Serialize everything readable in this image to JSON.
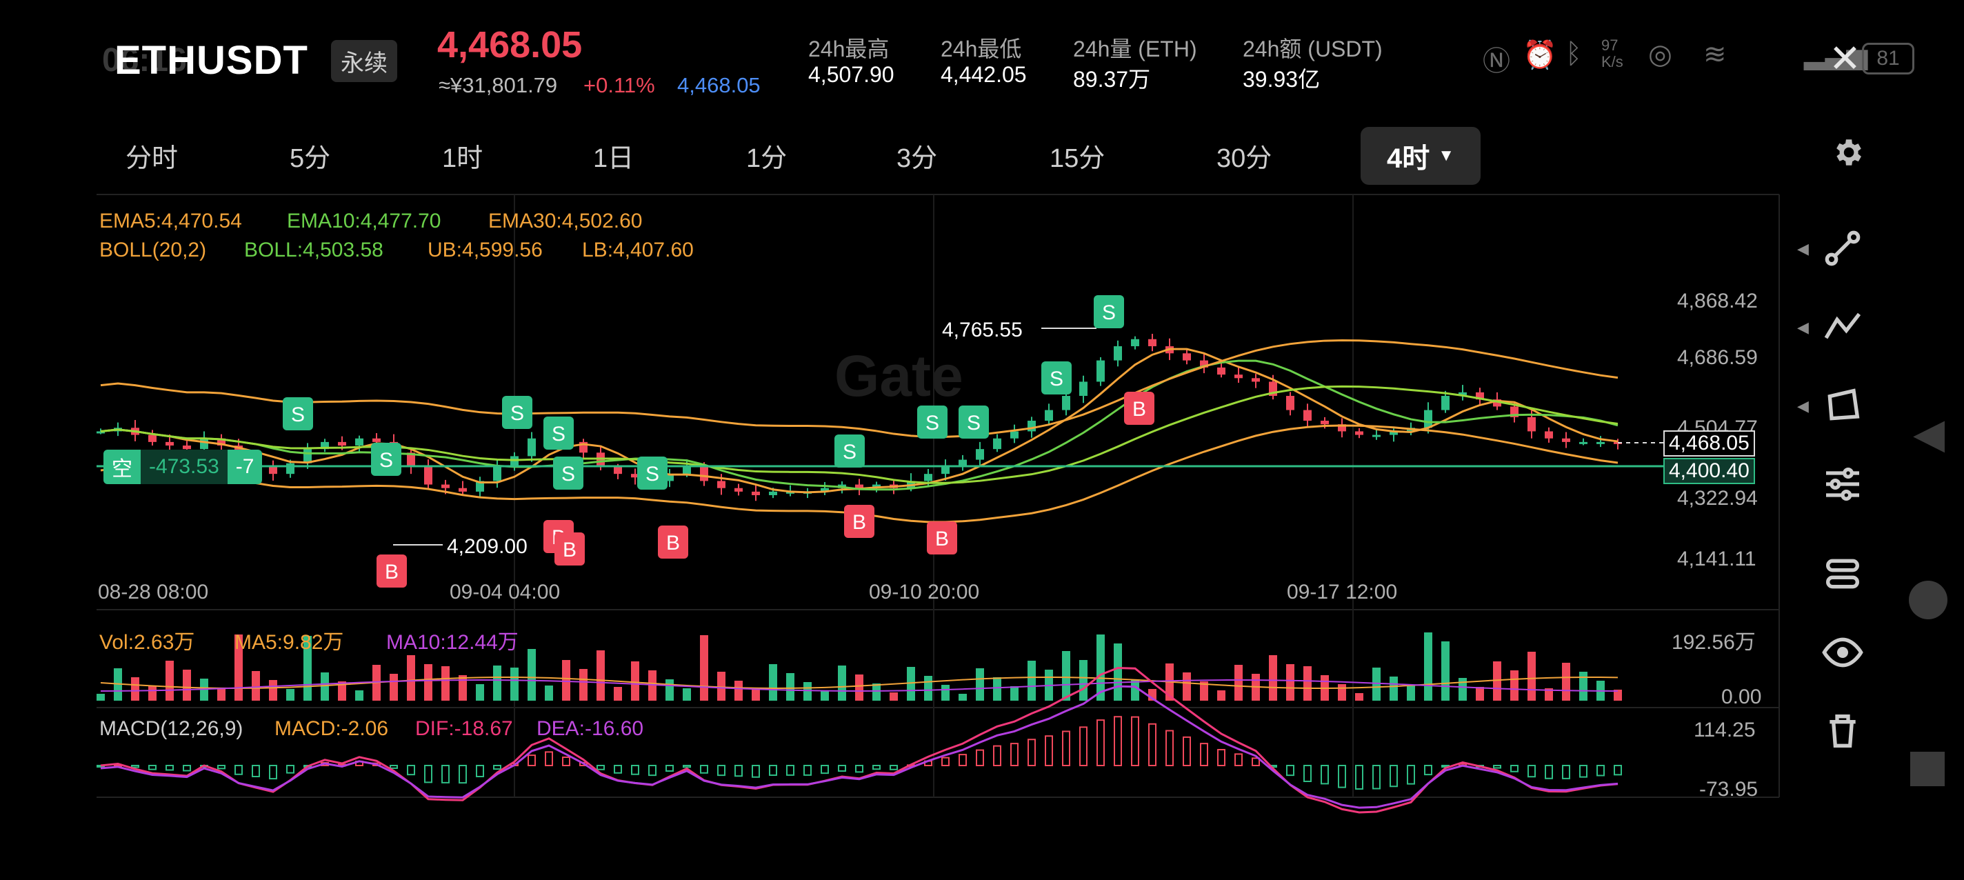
{
  "status": {
    "time": "06:16",
    "speed": "97 K/s",
    "battery": "81"
  },
  "header": {
    "symbol": "ETHUSDT",
    "badge": "永续",
    "price": "4,468.05",
    "cny": "≈¥31,801.79",
    "change": "+0.11%",
    "mark_price": "4,468.05",
    "stats": [
      {
        "label": "24h最高",
        "value": "4,507.90"
      },
      {
        "label": "24h最低",
        "value": "4,442.05"
      },
      {
        "label": "24h量 (ETH)",
        "value": "89.37万"
      },
      {
        "label": "24h额 (USDT)",
        "value": "39.93亿"
      }
    ]
  },
  "tabs": [
    "分时",
    "5分",
    "1时",
    "1日",
    "1分",
    "3分",
    "15分",
    "30分"
  ],
  "active_tab": "4时",
  "indicators": {
    "ema5": "EMA5:4,470.54",
    "ema10": "EMA10:4,477.70",
    "ema30": "EMA30:4,502.60",
    "boll": "BOLL(20,2)",
    "boll_mid": "BOLL:4,503.58",
    "boll_ub": "UB:4,599.56",
    "boll_lb": "LB:4,407.60",
    "vol": "Vol:2.63万",
    "vol_ma5": "MA5:9.82万",
    "vol_ma10": "MA10:12.44万",
    "macd": "MACD(12,26,9)",
    "macd_val": "MACD:-2.06",
    "dif": "DIF:-18.67",
    "dea": "DEA:-16.60"
  },
  "colors": {
    "up": "#2ebd85",
    "down": "#f0485a",
    "ema5": "#f2a33a",
    "ema10": "#6ad04a",
    "ema30": "#f2a33a",
    "boll": "#f2a33a",
    "dif": "#f0387a",
    "dea": "#b23ee0"
  },
  "axis": {
    "price_ticks": [
      "4,868.42",
      "4,686.59",
      "4,504.77",
      "4,322.94",
      "4,141.11"
    ],
    "vol_ticks": [
      "192.56万",
      "0.00"
    ],
    "macd_ticks": [
      "114.25",
      "-73.95"
    ],
    "x_ticks": [
      "08-28 08:00",
      "09-04 04:00",
      "09-10 20:00",
      "09-17 12:00"
    ]
  },
  "annotations": {
    "high": "4,765.55",
    "low": "4,209.00",
    "current": "4,468.05",
    "position_price": "4,400.40",
    "position_side": "空",
    "position_pnl": "-473.53",
    "position_qty": "-7"
  },
  "chart_data": {
    "type": "candlestick",
    "price_range": [
      4141.11,
      4868.42
    ],
    "approx_close_series": [
      4500,
      4510,
      4490,
      4470,
      4460,
      4450,
      4480,
      4460,
      4420,
      4400,
      4380,
      4410,
      4450,
      4470,
      4460,
      4480,
      4470,
      4440,
      4400,
      4350,
      4340,
      4330,
      4360,
      4400,
      4430,
      4480,
      4500,
      4470,
      4440,
      4400,
      4380,
      4370,
      4360,
      4380,
      4400,
      4360,
      4340,
      4330,
      4320,
      4330,
      4330,
      4330,
      4340,
      4350,
      4340,
      4350,
      4340,
      4360,
      4380,
      4400,
      4420,
      4450,
      4480,
      4500,
      4530,
      4560,
      4600,
      4640,
      4700,
      4740,
      4760,
      4740,
      4720,
      4700,
      4680,
      4660,
      4650,
      4640,
      4600,
      4560,
      4530,
      4520,
      4500,
      4490,
      4490,
      4500,
      4510,
      4560,
      4600,
      4610,
      4590,
      4570,
      4540,
      4500,
      4480,
      4470,
      4470,
      4470,
      4468
    ],
    "signals": {
      "S": 14,
      "B": 9
    }
  }
}
